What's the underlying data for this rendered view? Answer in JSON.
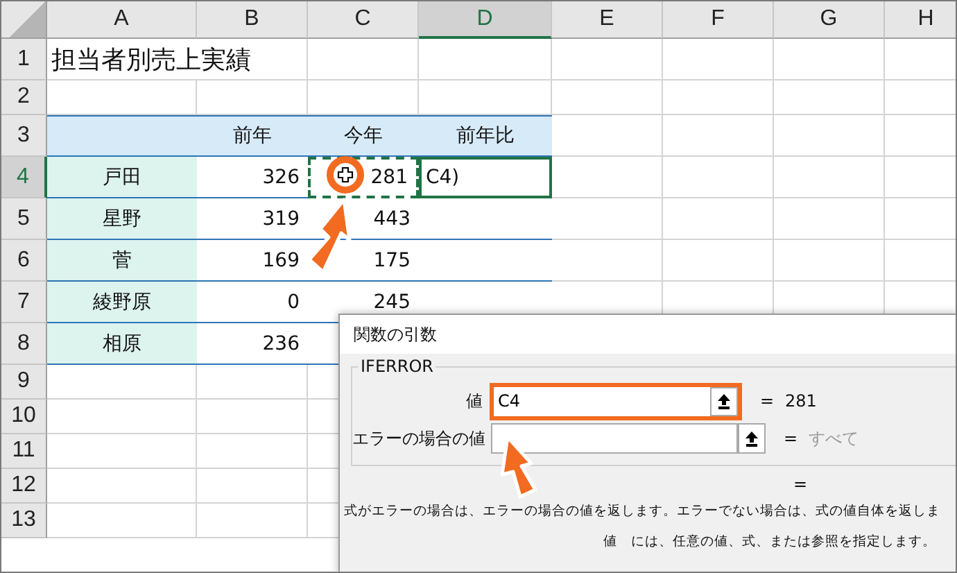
{
  "sheet": {
    "columns": [
      {
        "label": "A",
        "selected": false
      },
      {
        "label": "B",
        "selected": false
      },
      {
        "label": "C",
        "selected": false
      },
      {
        "label": "D",
        "selected": true
      },
      {
        "label": "E",
        "selected": false
      },
      {
        "label": "F",
        "selected": false
      },
      {
        "label": "G",
        "selected": false
      },
      {
        "label": "H",
        "selected": false
      }
    ],
    "rows": [
      {
        "label": "1",
        "selected": false,
        "kind": "title",
        "cells": [
          "担当者別売上実績"
        ]
      },
      {
        "label": "2",
        "selected": false,
        "kind": "blank",
        "cells": []
      },
      {
        "label": "3",
        "selected": false,
        "kind": "header",
        "cells": [
          "",
          "前年",
          "今年",
          "前年比"
        ]
      },
      {
        "label": "4",
        "selected": true,
        "kind": "data",
        "cells": [
          "戸田",
          "326",
          "281",
          "C4)"
        ]
      },
      {
        "label": "5",
        "selected": false,
        "kind": "data",
        "cells": [
          "星野",
          "319",
          "443"
        ]
      },
      {
        "label": "6",
        "selected": false,
        "kind": "data",
        "cells": [
          "菅",
          "169",
          "175"
        ]
      },
      {
        "label": "7",
        "selected": false,
        "kind": "data",
        "cells": [
          "綾野原",
          "0",
          "245"
        ]
      },
      {
        "label": "8",
        "selected": false,
        "kind": "data",
        "cells": [
          "相原",
          "236"
        ]
      },
      {
        "label": "9",
        "selected": false,
        "kind": "blank",
        "cells": []
      },
      {
        "label": "10",
        "selected": false,
        "kind": "blank",
        "cells": []
      },
      {
        "label": "11",
        "selected": false,
        "kind": "blank",
        "cells": []
      },
      {
        "label": "12",
        "selected": false,
        "kind": "blank",
        "cells": []
      },
      {
        "label": "13",
        "selected": false,
        "kind": "blank",
        "cells": []
      }
    ]
  },
  "dialog": {
    "title": "関数の引数",
    "function": "IFERROR",
    "arguments": [
      {
        "label": "値",
        "value": "C4",
        "result": "281",
        "highlighted": true,
        "muted": false
      },
      {
        "label": "エラーの場合の値",
        "result": "すべて",
        "highlighted": false,
        "muted": true
      }
    ],
    "equals": "=",
    "total": "=",
    "description": "式がエラーの場合は、エラーの場合の値を返します。エラーでない場合は、式の値自体を返しま",
    "argument_help": "値　には、任意の値、式、または参照を指定します。"
  }
}
